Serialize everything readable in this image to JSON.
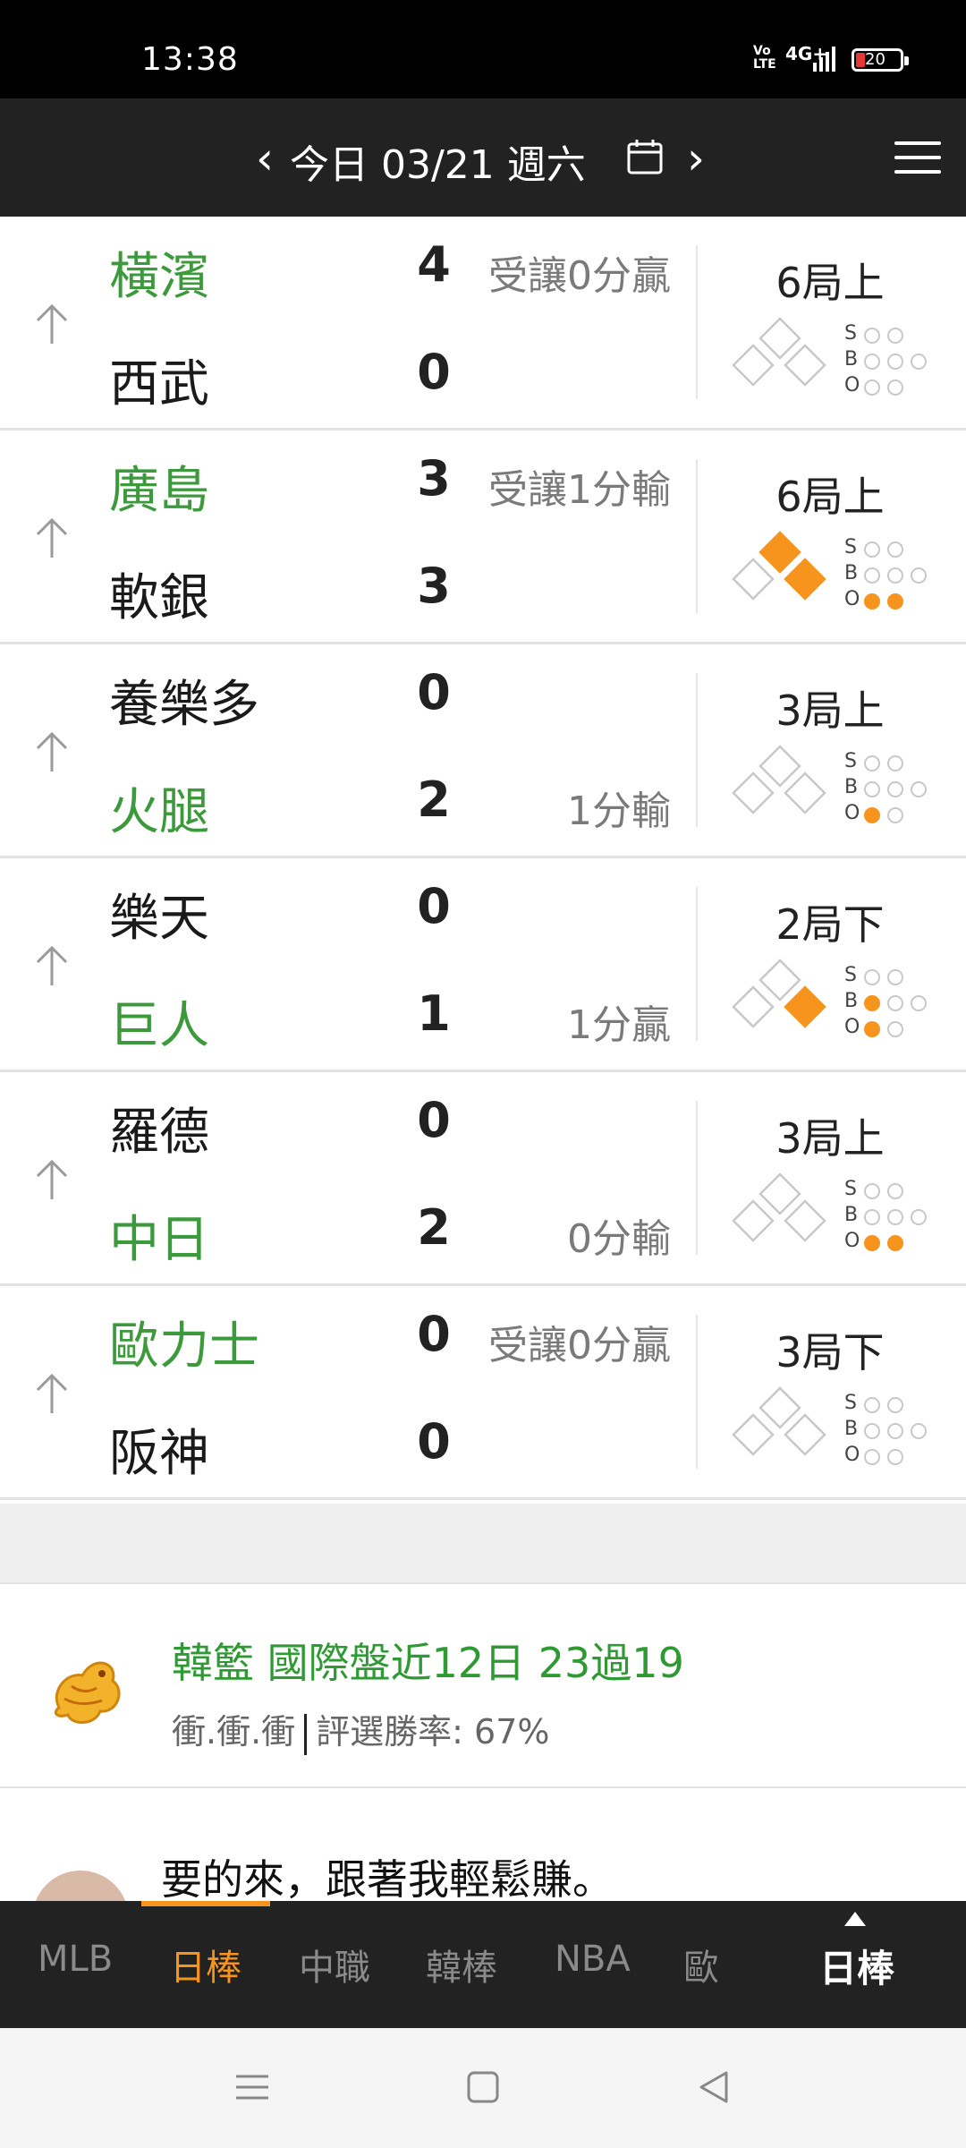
{
  "status_bar": {
    "time": "13:38",
    "volte": "Vo\nLTE",
    "network": "4G+",
    "battery": "20",
    "battery_color": "#e53935"
  },
  "header": {
    "prev_icon": "chevron-left-icon",
    "date": "今日 03/21 週六",
    "calendar_icon": "calendar-icon",
    "next_icon": "chevron-right-icon",
    "menu_icon": "hamburger-menu-icon"
  },
  "games": [
    {
      "team1": "橫濱",
      "team1_color": "green",
      "score1": "4",
      "line1": "受讓0分贏",
      "team2": "西武",
      "team2_color": "black",
      "score2": "0",
      "line2": "",
      "inning": "6局上",
      "bases": [
        false,
        false,
        false
      ],
      "strikes": 0,
      "balls": 0,
      "outs": 0
    },
    {
      "team1": "廣島",
      "team1_color": "green",
      "score1": "3",
      "line1": "受讓1分輸",
      "team2": "軟銀",
      "team2_color": "black",
      "score2": "3",
      "line2": "",
      "inning": "6局上",
      "bases": [
        true,
        true,
        false
      ],
      "strikes": 0,
      "balls": 0,
      "outs": 2
    },
    {
      "team1": "養樂多",
      "team1_color": "black",
      "score1": "0",
      "line1": "",
      "team2": "火腿",
      "team2_color": "green",
      "score2": "2",
      "line2": "1分輸",
      "inning": "3局上",
      "bases": [
        false,
        false,
        false
      ],
      "strikes": 0,
      "balls": 0,
      "outs": 1
    },
    {
      "team1": "樂天",
      "team1_color": "black",
      "score1": "0",
      "line1": "",
      "team2": "巨人",
      "team2_color": "green",
      "score2": "1",
      "line2": "1分贏",
      "inning": "2局下",
      "bases": [
        true,
        false,
        false
      ],
      "strikes": 0,
      "balls": 1,
      "outs": 1
    },
    {
      "team1": "羅德",
      "team1_color": "black",
      "score1": "0",
      "line1": "",
      "team2": "中日",
      "team2_color": "green",
      "score2": "2",
      "line2": "0分輸",
      "inning": "3局上",
      "bases": [
        false,
        false,
        false
      ],
      "strikes": 0,
      "balls": 0,
      "outs": 2
    },
    {
      "team1": "歐力士",
      "team1_color": "green",
      "score1": "0",
      "line1": "受讓0分贏",
      "team2": "阪神",
      "team2_color": "black",
      "score2": "0",
      "line2": "",
      "inning": "3局下",
      "bases": [
        false,
        false,
        false
      ],
      "strikes": 0,
      "balls": 0,
      "outs": 0
    }
  ],
  "colors": {
    "green": "#3c9a3c",
    "black": "#1a1a1a",
    "accent": "#f7941d",
    "header_bg": "#222222"
  },
  "promo": {
    "avatar_icon": "dragon-avatar-icon",
    "title": "韓籃 國際盤近12日 23過19",
    "author": "衝.衝.衝",
    "win_rate": "評選勝率: 67%"
  },
  "post": {
    "text": "要的來，跟著我輕鬆賺。"
  },
  "tabs": {
    "items": [
      "MLB",
      "日棒",
      "中職",
      "韓棒",
      "NBA",
      "歐"
    ],
    "active_index": 1,
    "current": "日棒"
  },
  "navbar": {
    "menu_icon": "recents-icon",
    "home_icon": "home-icon",
    "back_icon": "back-icon"
  }
}
